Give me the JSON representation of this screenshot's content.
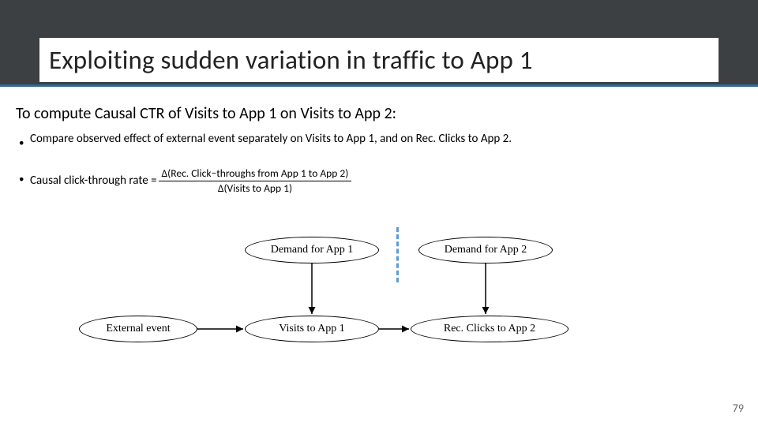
{
  "title": "Exploiting sudden variation in traffic to App 1",
  "lead": "To compute Causal CTR of Visits to App 1 on Visits to App 2:",
  "bullet1": "Compare observed effect of external event separately on Visits to App 1, and on Rec. Clicks to App 2.",
  "bullet2_prefix": "Causal click-through rate =",
  "bullet2_num": "Δ(Rec. Click−throughs from App 1 to App 2)",
  "bullet2_den": "Δ(Visits to App 1)",
  "nodes": {
    "demand1": "Demand for App 1",
    "demand2": "Demand for App 2",
    "external": "External event",
    "visits": "Visits to App 1",
    "clicks": "Rec. Clicks to App 2"
  },
  "page_number": "79"
}
